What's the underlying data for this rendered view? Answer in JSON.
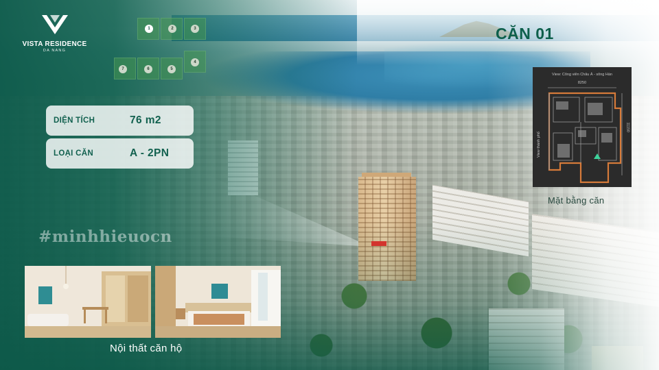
{
  "brand": {
    "name": "VISTA RESIDENCE",
    "city": "DA NANG",
    "accent_color": "#12614f"
  },
  "block_map": {
    "labels": [
      "1",
      "2",
      "3",
      "4",
      "5",
      "6",
      "7"
    ],
    "active": "1"
  },
  "title": "CĂN 01",
  "specs": [
    {
      "label": "DIỆN TÍCH",
      "value": "76 m2"
    },
    {
      "label": "LOẠI CĂN",
      "value": "A - 2PN"
    }
  ],
  "hashtag": "#minhhieuocn",
  "floorplan": {
    "view_label": "View: Công viên Châu Á - sông Hàn",
    "width_dim": "8250",
    "height_dim": "11150",
    "side_label": "View thành phố",
    "caption": "Mặt bằng căn"
  },
  "interior": {
    "caption": "Nội thất căn hộ",
    "photos": [
      "living-room",
      "bedroom"
    ]
  }
}
